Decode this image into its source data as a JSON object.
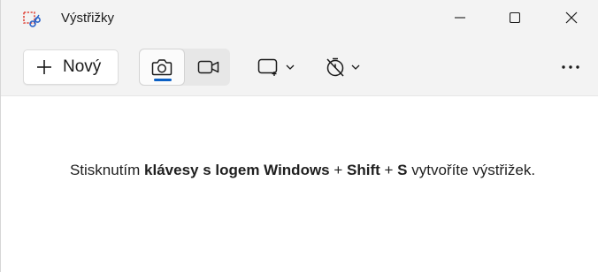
{
  "window": {
    "title": "Výstřižky"
  },
  "toolbar": {
    "new_label": "Nový",
    "mode_photo_icon": "camera-icon",
    "mode_video_icon": "video-camera-icon",
    "shape_icon": "rectangle-snip-icon",
    "timer_icon": "timer-off-icon",
    "more_icon": "more-horizontal-icon"
  },
  "content": {
    "instruction_prefix": "Stisknutím ",
    "instruction_bold1": "klávesy s logem Windows",
    "instruction_plus1": " + ",
    "instruction_bold2": "Shift",
    "instruction_plus2": " + ",
    "instruction_bold3": "S",
    "instruction_suffix": " vytvoříte výstřižek."
  },
  "colors": {
    "accent": "#0a5fc4",
    "titlebar_bg": "#f3f3f3",
    "content_bg": "#ffffff"
  }
}
